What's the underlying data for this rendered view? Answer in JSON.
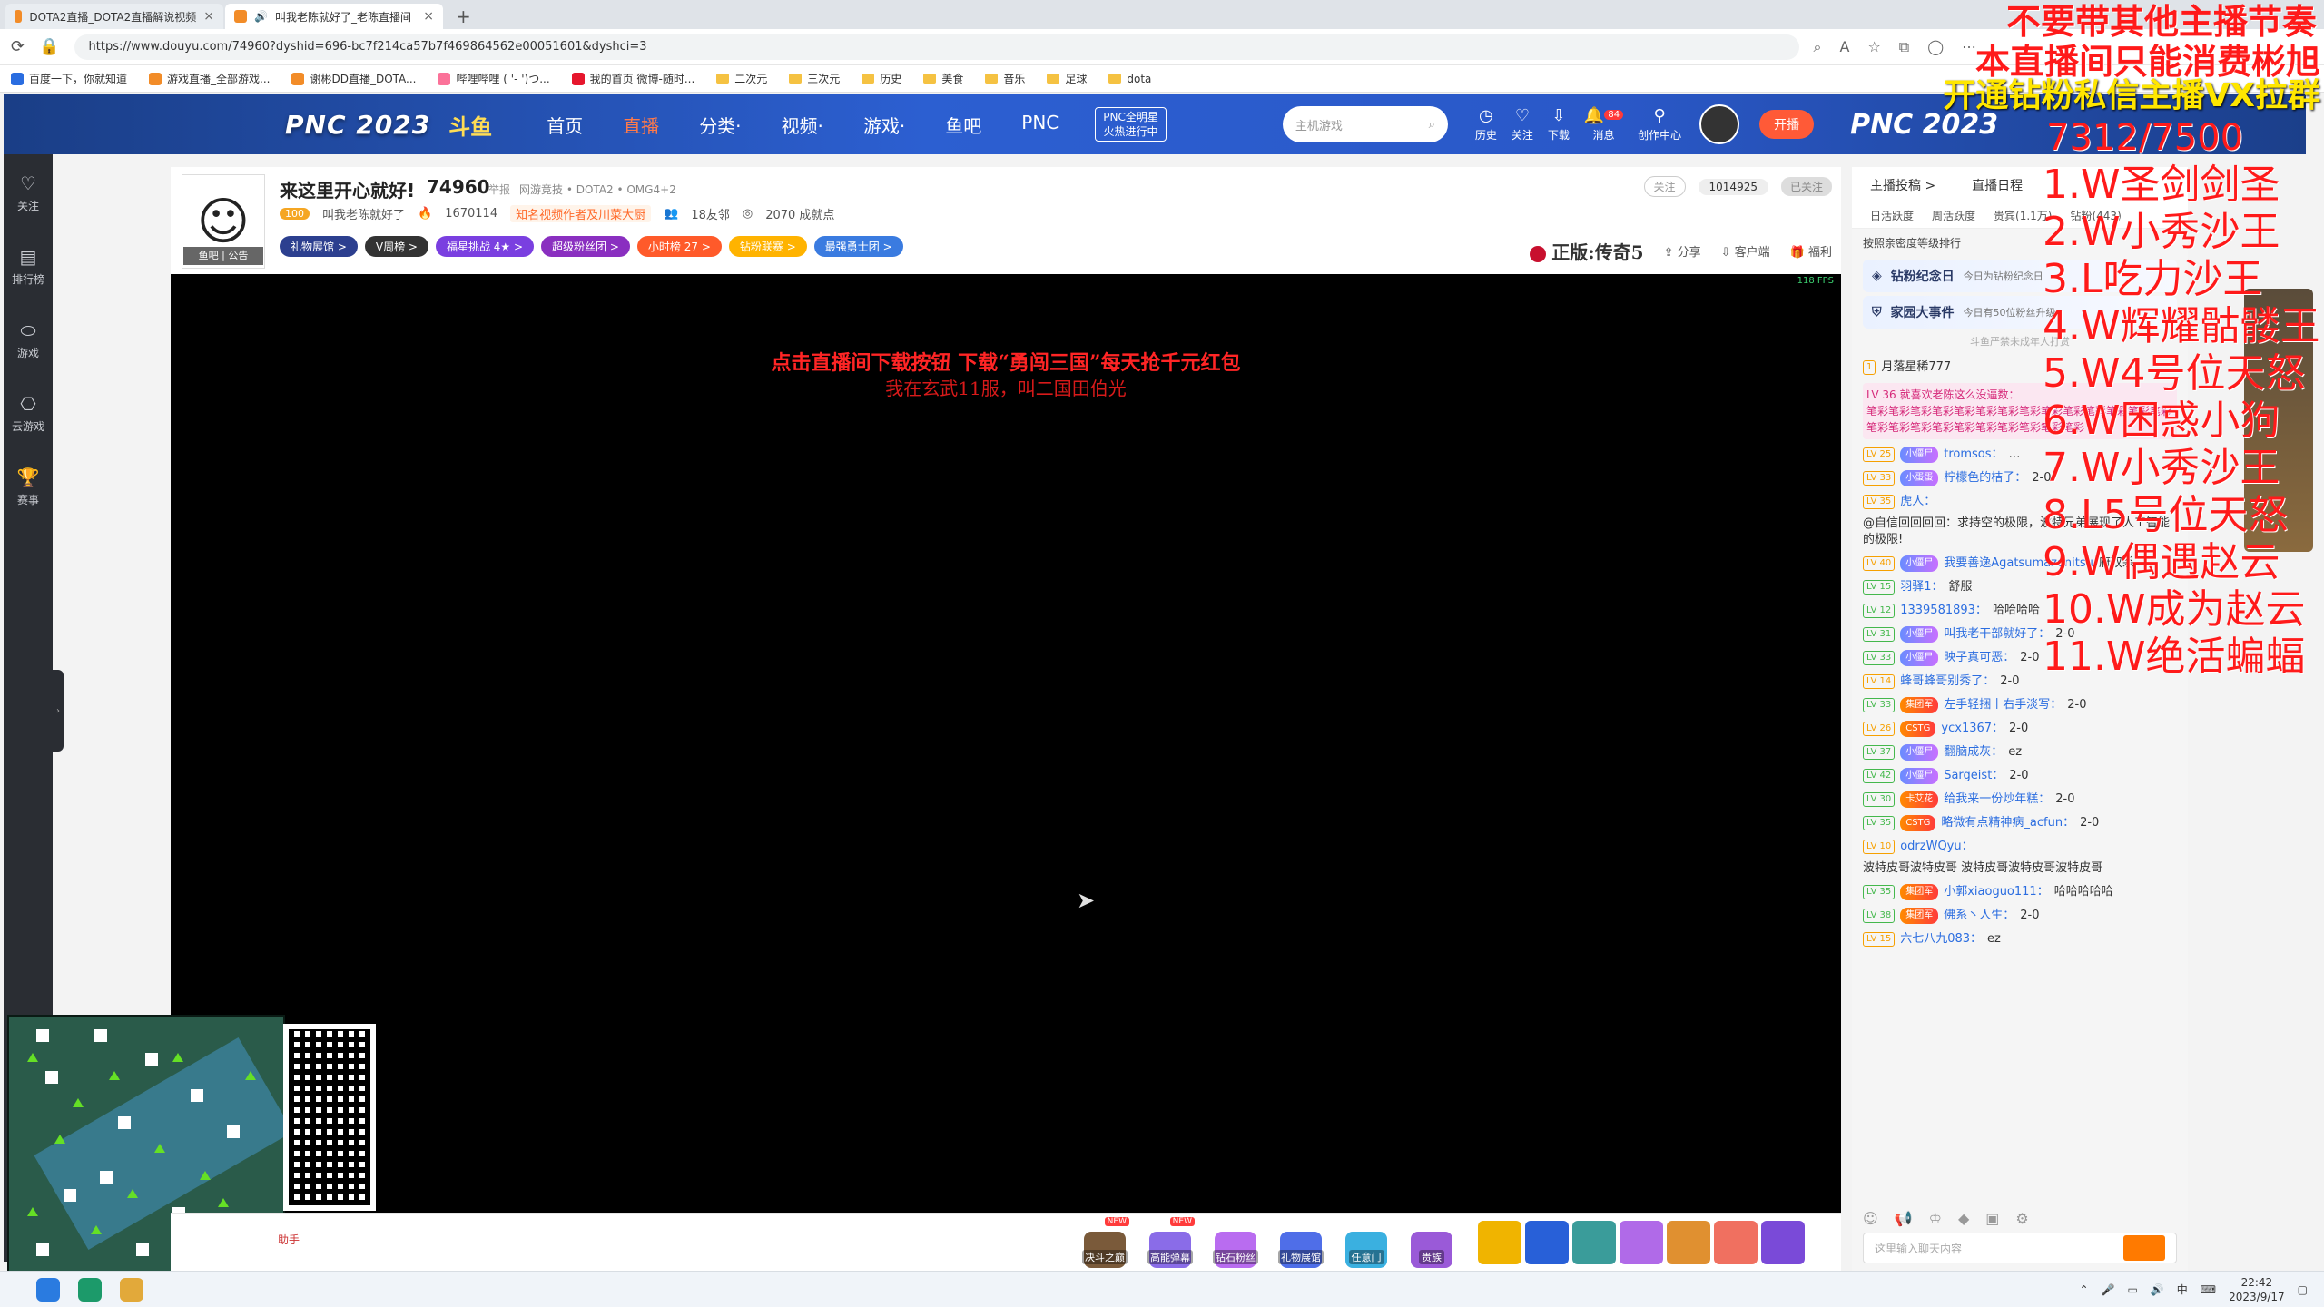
{
  "browser": {
    "tabs": [
      {
        "label": "DOTA2直播_DOTA2直播解说视频",
        "active": false
      },
      {
        "label": "叫我老陈就好了_老陈直播间",
        "active": true
      }
    ],
    "new_tab": "+",
    "url": "https://www.douyu.com/74960?dyshid=696-bc7f214ca57b7f469864562e00051601&dyshci=3",
    "bookmarks": [
      "百度一下，你就知道",
      "游戏直播_全部游戏...",
      "谢彬DD直播_DOTA...",
      "哔哩哔哩 ( '- ')つ...",
      "我的首页 微博-随时...",
      "二次元",
      "三次元",
      "历史",
      "美食",
      "音乐",
      "足球",
      "dota"
    ]
  },
  "header": {
    "pnc_logo": "PNC 2023",
    "douyu_logo": "斗鱼",
    "nav": [
      "首页",
      "直播",
      "分类·",
      "视频·",
      "游戏·",
      "鱼吧",
      "PNC"
    ],
    "active_nav": "直播",
    "star_badge_line1": "PNC全明星",
    "star_badge_line2": "火热进行中",
    "search_placeholder": "主机游戏",
    "icons": [
      {
        "label": "历史",
        "icon": "history-icon"
      },
      {
        "label": "关注",
        "icon": "heart-icon"
      },
      {
        "label": "下载",
        "icon": "download-icon"
      },
      {
        "label": "消息",
        "icon": "bell-icon",
        "count": "84"
      },
      {
        "label": "创作中心",
        "icon": "location-icon"
      }
    ],
    "live_btn": "开播",
    "pnc_logo_right": "PNC 2023"
  },
  "leftbar": [
    {
      "label": "关注",
      "icon": "heart-icon"
    },
    {
      "label": "排行榜",
      "icon": "rank-icon"
    },
    {
      "label": "游戏",
      "icon": "game-icon"
    },
    {
      "label": "云游戏",
      "icon": "cloud-game-icon"
    },
    {
      "label": "赛事",
      "icon": "trophy-icon"
    }
  ],
  "room": {
    "title": "来这里开心就好!",
    "room_id": "74960",
    "report": "举报",
    "breadcrumb": "网游竞技 • DOTA2 • OMG4+2",
    "avatar_caption": "鱼吧 | 公告",
    "level": "100",
    "anchor_name": "叫我老陈就好了",
    "hot": "1670114",
    "cert": "知名视频作者及川菜大厨",
    "friends": "18友邻",
    "achievements": "2070 成就点",
    "tags": [
      {
        "label": "礼物展馆 >",
        "color": "#2c3f8f"
      },
      {
        "label": "V周榜 >",
        "color": "#333"
      },
      {
        "label": "福星挑战 4★ >",
        "color": "#7a3fe0"
      },
      {
        "label": "超级粉丝团 >",
        "color": "#8a2fc0"
      },
      {
        "label": "小时榜 27 >",
        "color": "#ff5a2a"
      },
      {
        "label": "钻粉联赛 >",
        "color": "#ffb300"
      },
      {
        "label": "最强勇士团 >",
        "color": "#3a7be0"
      }
    ],
    "follow": "关注",
    "fans_count": "1014925",
    "followed": "已关注",
    "game": "正版:传奇5",
    "share": "分享",
    "client": "客户端",
    "welfare": "福利"
  },
  "video": {
    "fps": "118 FPS",
    "promo_line1": "点击直播间下载按钮 下载“勇闯三国”每天抢千元红包",
    "promo_line2": "我在玄武11服，叫二国田伯光"
  },
  "gifts": {
    "items": [
      {
        "label": "决斗之巅",
        "new": "NEW"
      },
      {
        "label": "高能弹幕",
        "new": "NEW"
      },
      {
        "label": "钻石粉丝",
        "new": ""
      },
      {
        "label": "礼物展馆",
        "new": ""
      },
      {
        "label": "任意门",
        "new": ""
      },
      {
        "label": "贵族",
        "new": ""
      }
    ],
    "left_label": "助手"
  },
  "chat": {
    "top": [
      "主播投稿 >",
      "直播日程"
    ],
    "tabs": [
      "日活跃度",
      "周活跃度",
      "贵宾(1.1万)",
      "钻粉(443)"
    ],
    "sort": "按照亲密度等级排行",
    "card1_title": "钻粉纪念日",
    "card1_sub": "今日为钻粉纪念日",
    "card2_title": "家园大事件",
    "card2_sub": "今日有50位粉丝升级",
    "tip": "斗鱼严禁未成年人打赏",
    "rank1_name": "月落星稀777",
    "pink_head": "LV 36  就喜欢老陈这么没逼数：",
    "pink_body": "笔彩笔彩笔彩笔彩笔彩笔彩笔彩笔彩笔彩笔彩笔彩笔彩笔彩笔彩笔彩笔彩笔彩笔彩笔彩笔彩笔彩笔彩笔彩笔彩",
    "messages": [
      {
        "lv": "LV 25",
        "guard": "小僵尸",
        "name": "tromsos：",
        "text": "…",
        "go": false
      },
      {
        "lv": "LV 33",
        "guard": "小蛋蛋",
        "name": "柠檬色的桔子：",
        "text": "2-0",
        "go": false
      },
      {
        "lv": "LV 35",
        "guard": "",
        "name": "虎人：",
        "text": "@自信回回回回：求持空的极限，波特兄弟展现了人工智能的极限!",
        "go": false
      },
      {
        "lv": "LV 40",
        "guard": "小僵尸",
        "name": "我要善逸Agatsumazenitsu",
        "text": "府双杀",
        "go": false
      },
      {
        "lv": "LV 15",
        "guard": "",
        "name": "羽驿1：",
        "text": "舒服",
        "go": true
      },
      {
        "lv": "LV 12",
        "guard": "",
        "name": "1339581893：",
        "text": "哈哈哈哈",
        "go": true
      },
      {
        "lv": "LV 31",
        "guard": "小僵尸",
        "name": "叫我老干部就好了：",
        "text": "2-0",
        "go": true
      },
      {
        "lv": "LV 33",
        "guard": "小僵尸",
        "name": "映子真可恶：",
        "text": "2-0",
        "go": true
      },
      {
        "lv": "LV 14",
        "guard": "",
        "name": "蜂哥蜂哥别秀了：",
        "text": "2-0",
        "go": false
      },
      {
        "lv": "LV 33",
        "guard": "集团军",
        "name": "左手轻捆丨右手淡写：",
        "text": "2-0",
        "go": true
      },
      {
        "lv": "LV 26",
        "guard": "CSTG",
        "name": "ycx1367：",
        "text": "2-0",
        "go": false
      },
      {
        "lv": "LV 37",
        "guard": "小僵尸",
        "name": "翻脑成灰：",
        "text": "ez",
        "go": true
      },
      {
        "lv": "LV 42",
        "guard": "小僵尸",
        "name": "Sargeist：",
        "text": "2-0",
        "go": true
      },
      {
        "lv": "LV 30",
        "guard": "卡艾花",
        "name": "给我来一份炒年糕：",
        "text": "2-0",
        "go": true
      },
      {
        "lv": "LV 35",
        "guard": "CSTG",
        "name": "略微有点精神病_acfun：",
        "text": "2-0",
        "go": true
      },
      {
        "lv": "LV 10",
        "guard": "",
        "name": "odrzWQyu：",
        "text": "波特皮哥波特皮哥 波特皮哥波特皮哥波特皮哥",
        "go": false
      },
      {
        "lv": "LV 35",
        "guard": "集团军",
        "name": "小郭xiaoguo111：",
        "text": "哈哈哈哈哈",
        "go": true
      },
      {
        "lv": "LV 38",
        "guard": "集团军",
        "name": "佛系丶人生：",
        "text": "2-0",
        "go": true
      },
      {
        "lv": "LV 15",
        "guard": "",
        "name": "六七八九083：",
        "text": "ez",
        "go": false
      }
    ],
    "input_placeholder": "这里输入聊天内容"
  },
  "overlay": {
    "line1": "不要带其他主播节奏",
    "line2": "本直播间只能消费彬旭",
    "line3": "开通钻粉私信主播VX拉群",
    "progress": "7312/7500",
    "list": [
      "1.W圣剑剑圣",
      "2.W小秀沙王",
      "3.L吃力沙王",
      "4.W辉耀骷髅王",
      "5.W4号位天怒",
      "6.W困惑小狗",
      "7.W小秀沙王",
      "8.L5号位天怒",
      "9.W偶遇赵云",
      "10.W成为赵云",
      "11.W绝活蝙蝠"
    ]
  },
  "taskbar": {
    "time": "22:42",
    "date": "2023/9/17",
    "ime": "中"
  }
}
